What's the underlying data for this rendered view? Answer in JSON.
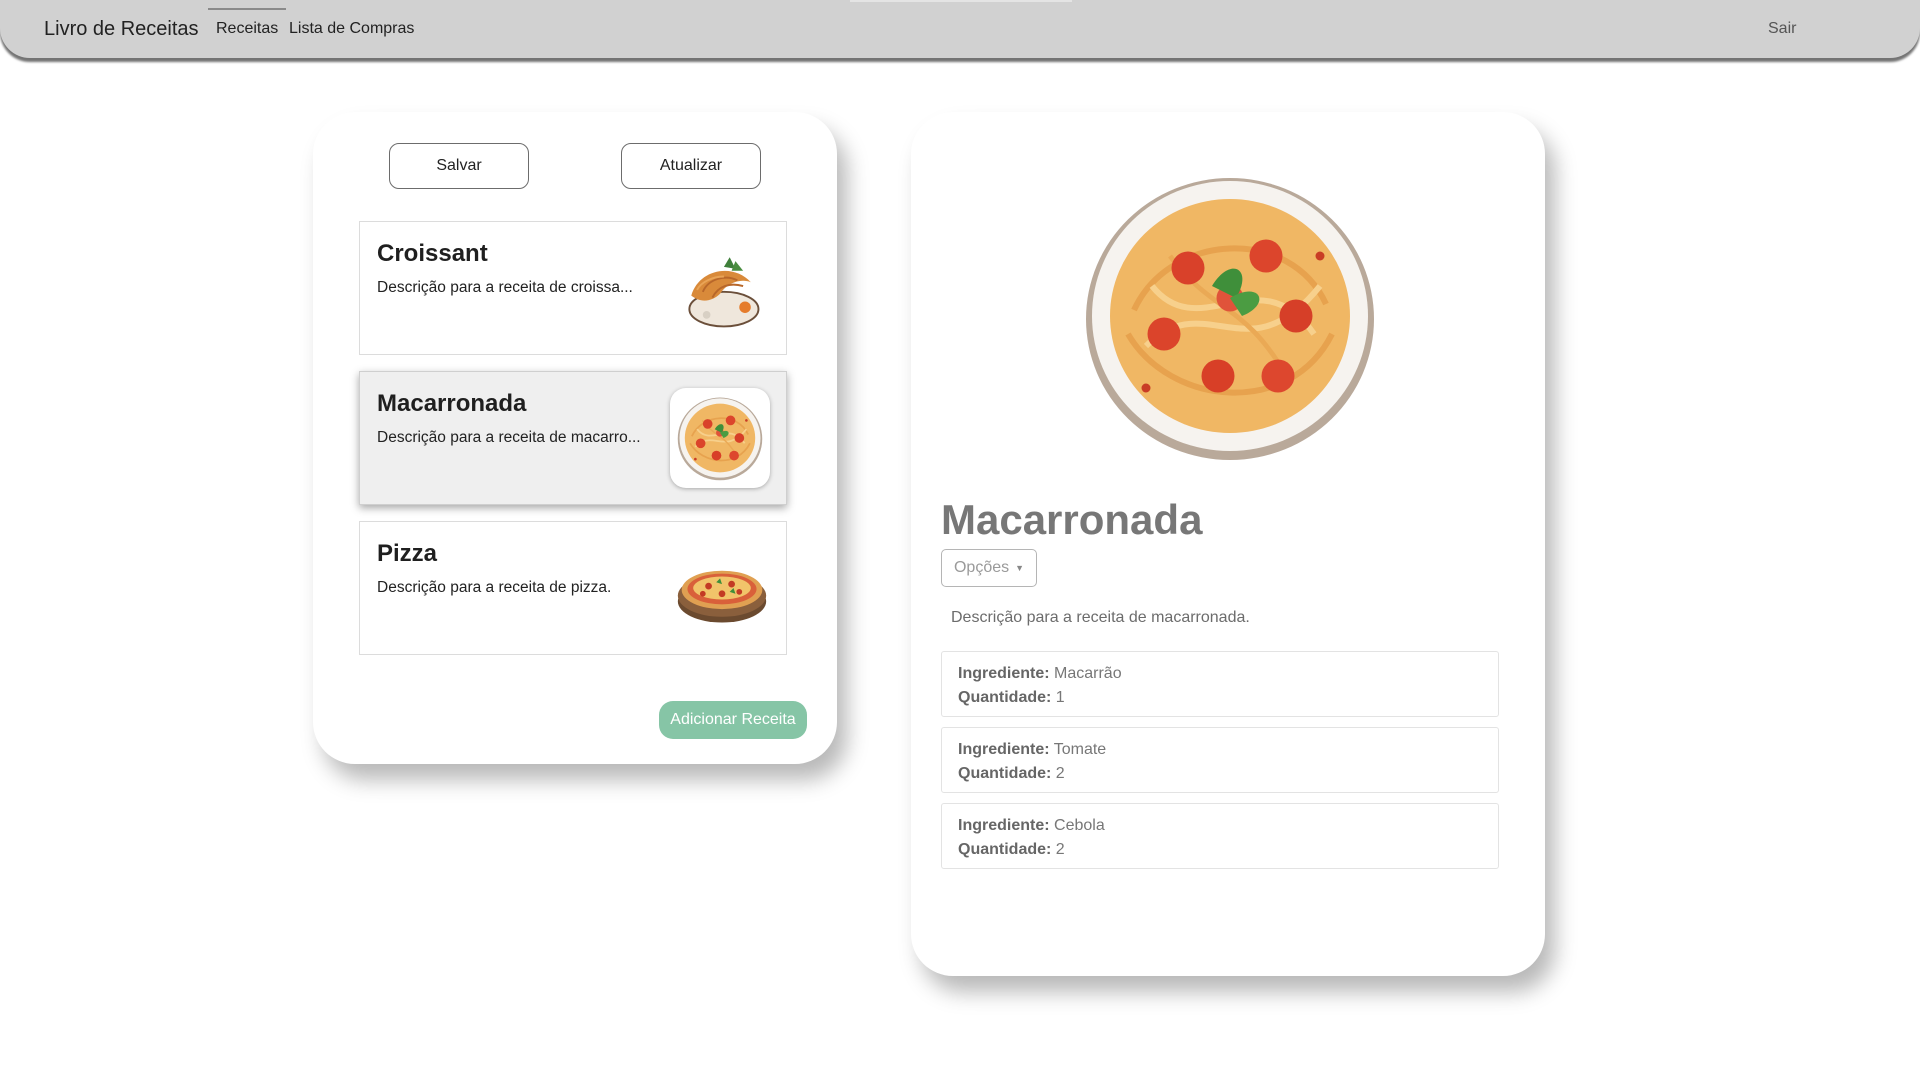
{
  "navbar": {
    "brand": "Livro de Receitas",
    "links": [
      {
        "label": "Receitas",
        "active": true
      },
      {
        "label": "Lista de Compras",
        "active": false
      }
    ],
    "logout": "Sair"
  },
  "list_panel": {
    "save_label": "Salvar",
    "update_label": "Atualizar",
    "add_label": "Adicionar Receita",
    "recipes": [
      {
        "name": "Croissant",
        "description": "Descrição para a receita de croissa...",
        "selected": false,
        "image": "croissant-image"
      },
      {
        "name": "Macarronada",
        "description": "Descrição para a receita de macarro...",
        "selected": true,
        "image": "spaghetti-image"
      },
      {
        "name": "Pizza",
        "description": "Descrição para a receita de pizza.",
        "selected": false,
        "image": "pizza-image"
      }
    ]
  },
  "detail": {
    "image": "spaghetti-image",
    "title": "Macarronada",
    "options_label": "Opções",
    "description": "Descrição para a receita de macarronada.",
    "ingredient_label": "Ingrediente:",
    "quantity_label": "Quantidade:",
    "ingredients": [
      {
        "name": "Macarrão",
        "quantity": "1"
      },
      {
        "name": "Tomate",
        "quantity": "2"
      },
      {
        "name": "Cebola",
        "quantity": "2"
      }
    ]
  },
  "colors": {
    "navbar_bg": "#d1d1d1",
    "add_button": "#86c5a6",
    "selected_item_bg": "#efefef"
  }
}
